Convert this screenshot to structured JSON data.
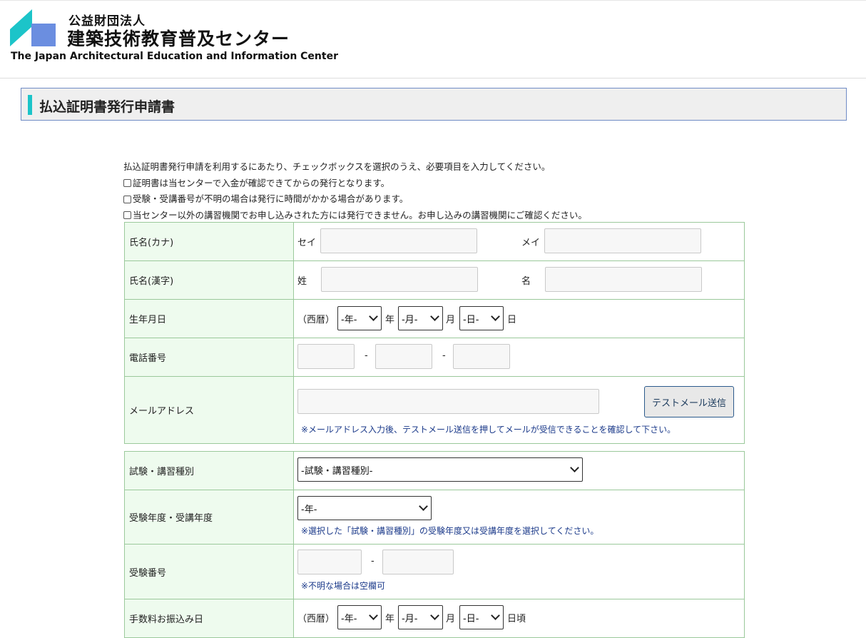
{
  "header": {
    "org_small": "公益財団法人",
    "org_name": "建築技術教育普及センター",
    "org_en": "The Japan Architectural Education and Information Center"
  },
  "page": {
    "title": "払込証明書発行申請書"
  },
  "intro": {
    "lead": "払込証明書発行申請を利用するにあたり、チェックボックスを選択のうえ、必要項目を入力してください。",
    "checks": [
      "証明書は当センターで入金が確認できてからの発行となります。",
      "受験・受講番号が不明の場合は発行に時間がかかる場合があります。",
      "当センター以外の講習機関でお申し込みされた方には発行できません。お申し込みの講習機関にご確認ください。"
    ]
  },
  "form1": {
    "kana": {
      "label": "氏名(カナ)",
      "sei": "セイ",
      "mei": "メイ"
    },
    "kanji": {
      "label": "氏名(漢字)",
      "sei": "姓",
      "mei": "名"
    },
    "birth": {
      "label": "生年月日",
      "era": "（西暦）",
      "year_sel": "-年-",
      "year_unit": "年",
      "month_sel": "-月-",
      "month_unit": "月",
      "day_sel": "-日-",
      "day_unit": "日"
    },
    "phone": {
      "label": "電話番号",
      "sep": "-"
    },
    "email": {
      "label": "メールアドレス",
      "button": "テストメール送信",
      "note": "※メールアドレス入力後、テストメール送信を押してメールが受信できることを確認して下さい。"
    }
  },
  "form2": {
    "exam_type": {
      "label": "試験・講習種別",
      "select": "-試験・講習種別-"
    },
    "exam_year": {
      "label": "受験年度・受講年度",
      "select": "-年-",
      "note": "※選択した「試験・講習種別」の受験年度又は受講年度を選択してください。"
    },
    "exam_no": {
      "label": "受験番号",
      "sep": "-",
      "note": "※不明な場合は空欄可"
    },
    "pay_date": {
      "label": "手数料お振込み日",
      "era": "（西暦）",
      "year_sel": "-年-",
      "year_unit": "年",
      "month_sel": "-月-",
      "month_unit": "月",
      "day_sel": "-日-",
      "day_unit": "日頃"
    }
  },
  "colors": {
    "accent": "#1cc4c9",
    "logo_blue": "#6b8ee0",
    "label_bg": "#eefbee",
    "border": "#9bc99b",
    "note": "#1b3a8a"
  }
}
